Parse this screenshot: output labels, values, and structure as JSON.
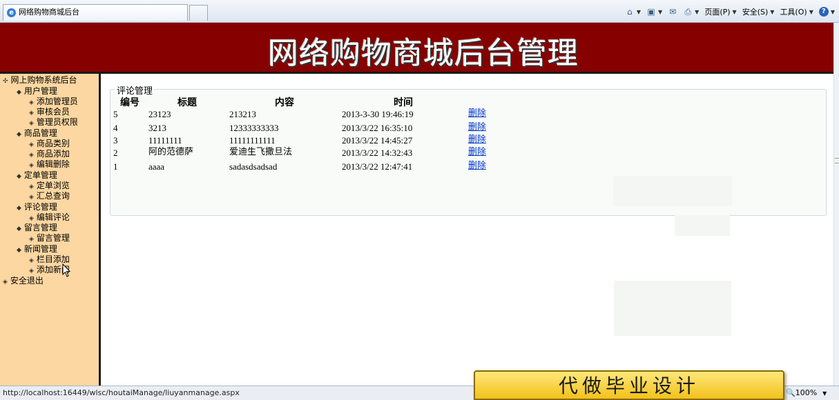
{
  "browser": {
    "tab_title": "网络购物商城后台",
    "ie_glyph": "e",
    "commands": [
      {
        "icon": "home-icon",
        "label": ""
      },
      {
        "icon": "rss-feed-icon",
        "label": ""
      },
      {
        "icon": "mail-icon",
        "label": ""
      },
      {
        "icon": "print-icon",
        "label": ""
      },
      {
        "icon": "page-menu",
        "label": "页面(P)"
      },
      {
        "icon": "safety-menu",
        "label": "安全(S)"
      },
      {
        "icon": "tools-menu",
        "label": "工具(O)"
      },
      {
        "icon": "help-icon",
        "label": "?"
      }
    ],
    "status_url": "http://localhost:16449/wlsc/houtaiManage/liuyanmanage.aspx",
    "zoom": "100%"
  },
  "banner": {
    "title": "网络购物商城后台管理"
  },
  "sidebar": {
    "root": "网上购物系统后台",
    "groups": [
      {
        "label": "用户管理",
        "items": [
          "添加管理员",
          "审核会员",
          "管理员权限"
        ]
      },
      {
        "label": "商品管理",
        "items": [
          "商品类别",
          "商品添加",
          "编辑删除"
        ]
      },
      {
        "label": "定单管理",
        "items": [
          "定单浏览",
          "汇总查询"
        ]
      },
      {
        "label": "评论管理",
        "items": [
          "编辑评论"
        ]
      },
      {
        "label": "留言管理",
        "items": [
          "留言管理"
        ]
      },
      {
        "label": "新闻管理",
        "items": [
          "栏目添加",
          "添加新闻"
        ]
      }
    ],
    "logout": "安全退出"
  },
  "comments": {
    "legend": "评论管理",
    "headers": [
      "编号",
      "标题",
      "内容",
      "时间"
    ],
    "delete_label": "删除",
    "rows": [
      {
        "id": "5",
        "title": "23123",
        "content": "213213",
        "time": "2013-3-30 19:46:19"
      },
      {
        "id": "4",
        "title": "3213",
        "content": "12333333333",
        "time": "2013/3/22 16:35:10"
      },
      {
        "id": "3",
        "title": "11111111",
        "content": "11111111111",
        "time": "2013/3/22 14:45:27"
      },
      {
        "id": "2",
        "title": "阿的范德萨",
        "content": "爱迪生飞撒旦法",
        "time": "2013/3/22 14:32:43"
      },
      {
        "id": "1",
        "title": "aaaa",
        "content": "sadasdsadsad",
        "time": "2013/3/22 12:47:41"
      }
    ]
  },
  "ad": {
    "text": "代做毕业设计"
  }
}
